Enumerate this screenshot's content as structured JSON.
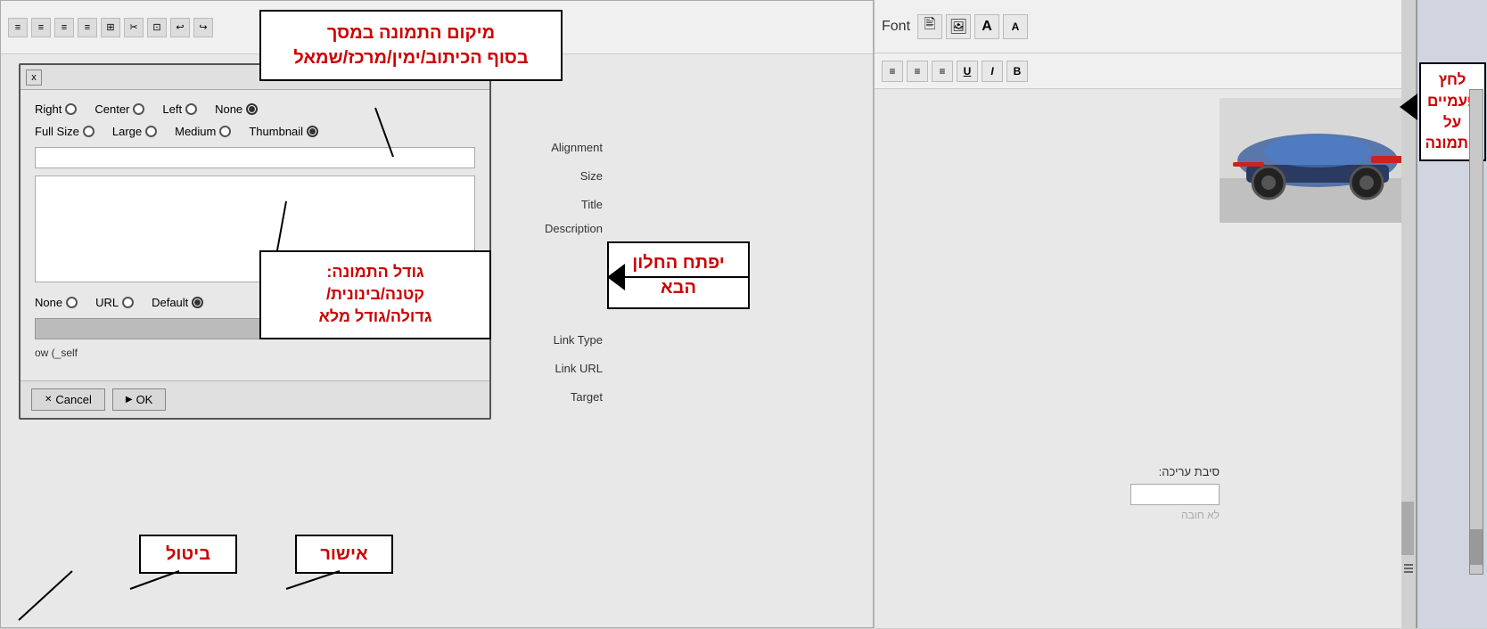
{
  "dialog": {
    "close_btn": "x",
    "alignment_label": "Alignment",
    "size_label": "Size",
    "title_label": "Title",
    "description_label": "Description",
    "link_type_label": "Link Type",
    "link_url_label": "Link URL",
    "target_label": "Target",
    "alignment_options": [
      "Right",
      "Center",
      "Left",
      "None"
    ],
    "size_options": [
      "Full Size",
      "Large",
      "Medium",
      "Thumbnail"
    ],
    "link_options": [
      "None",
      "URL",
      "Default"
    ],
    "target_value": "ow (_self",
    "cancel_label": "Cancel",
    "ok_label": "OK"
  },
  "toolbar": {
    "font_label": "Font",
    "format_btns": [
      "A",
      "A"
    ],
    "align_btns": [
      "≡",
      "≡",
      "≡",
      "U",
      "I",
      "B"
    ]
  },
  "annotations": {
    "top_box": {
      "line1": "מיקום התמונה במסך",
      "line2": "בסוף הכיתוב/ימין/מרכז/שמאל"
    },
    "middle_box": {
      "line1": "גודל התמונה:",
      "line2": "קטנה/בינונית/",
      "line3": "גדולה/גודל מלא"
    },
    "right_box": {
      "line1": "לחץ",
      "line2": "פעמיים על",
      "line3": "התמונה"
    },
    "bottom_left_label": "ביטול",
    "bottom_right_label": "אישור",
    "next_window_label": "יפתח החלון הבא"
  },
  "right_panel": {
    "edit_label": "סיבת עריכה:",
    "not_required": "לא חובה"
  }
}
